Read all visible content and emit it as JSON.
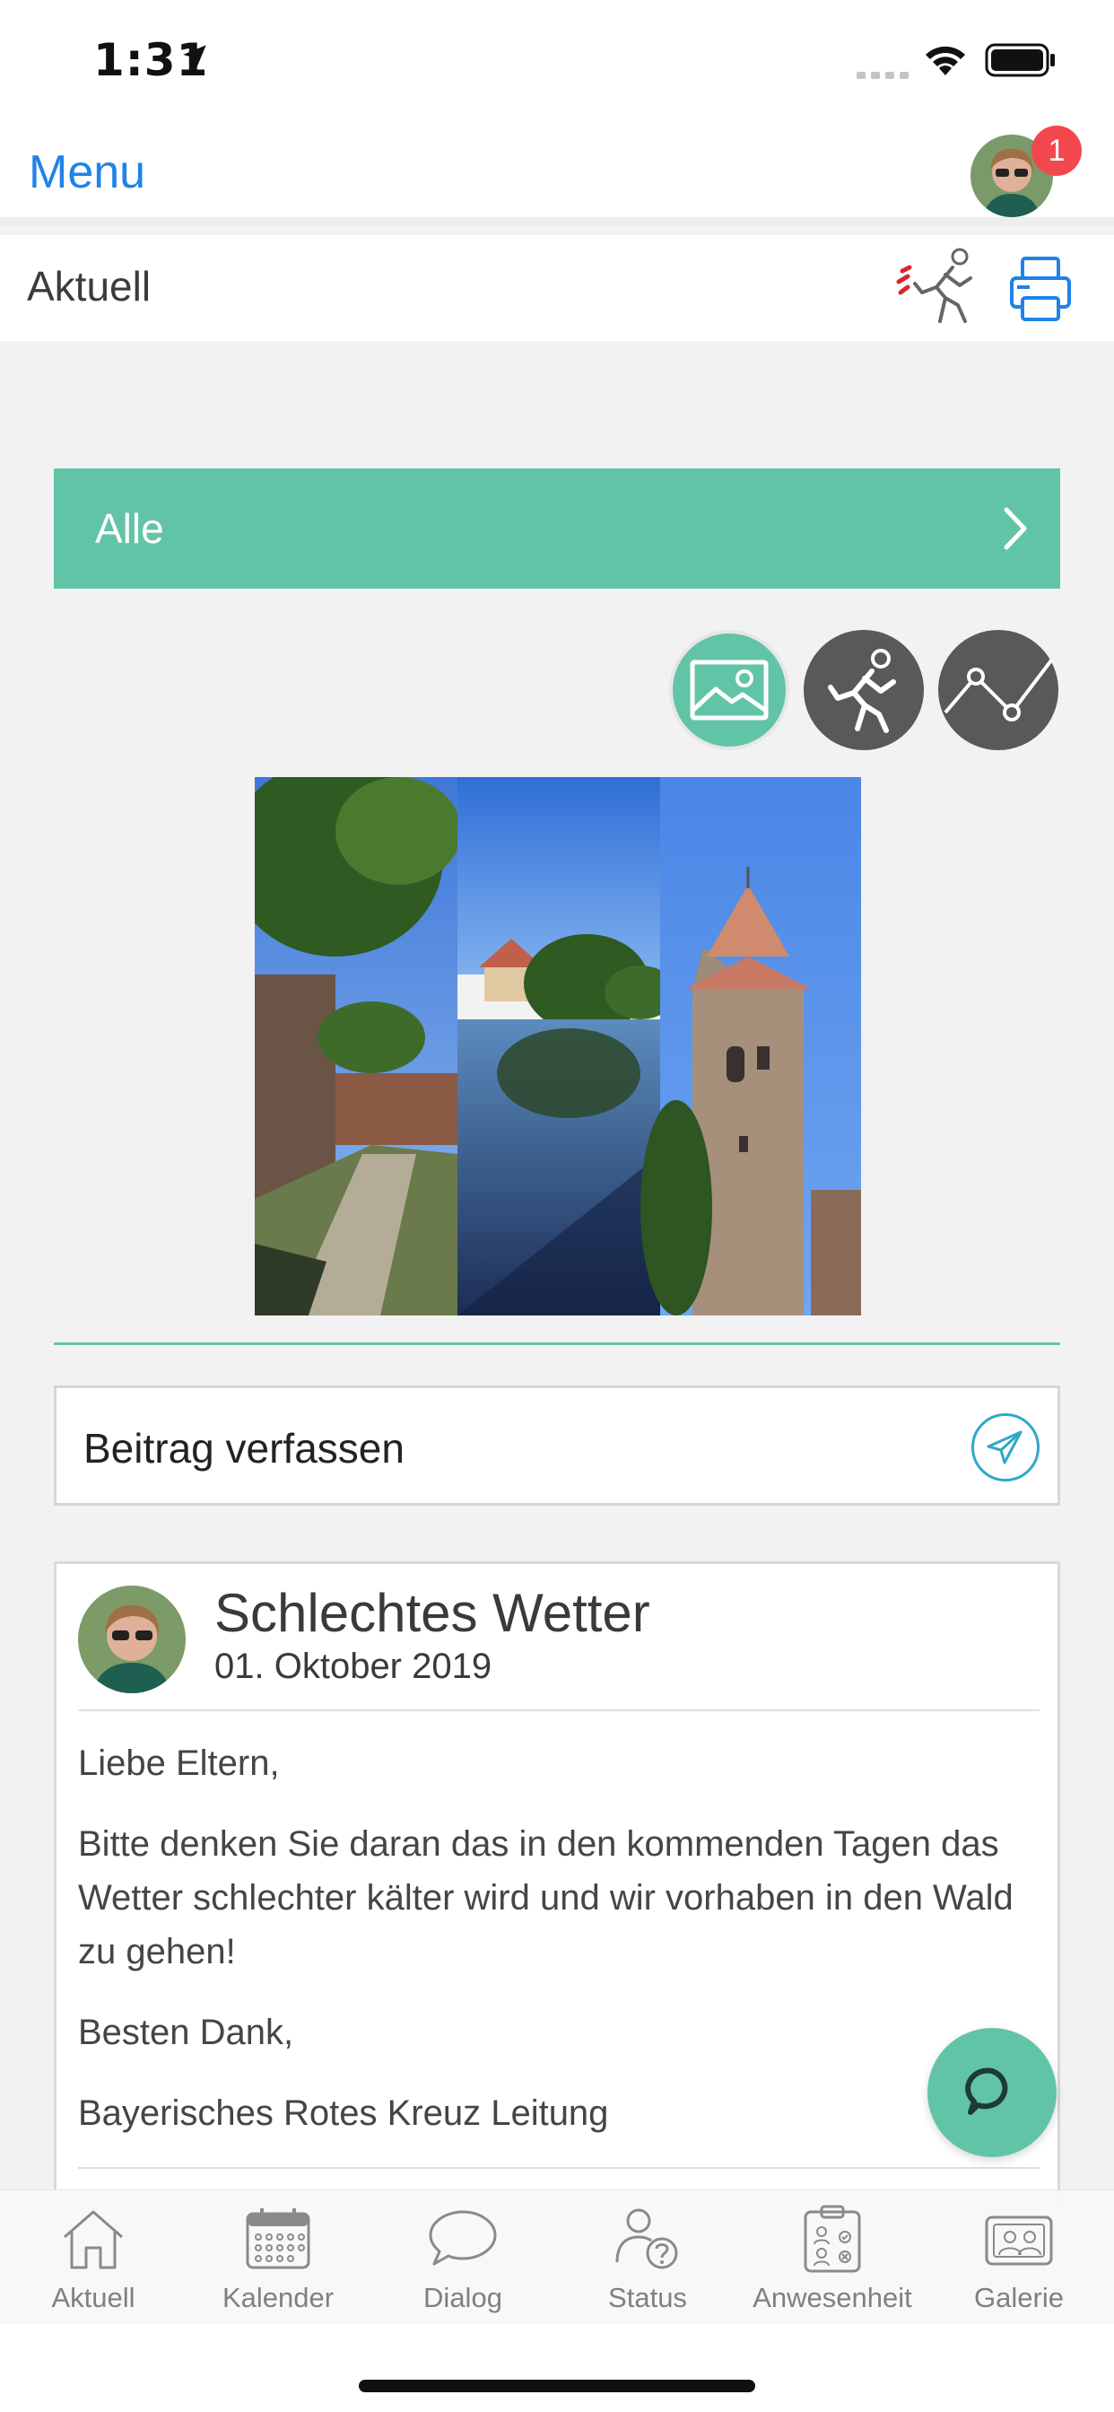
{
  "status_bar": {
    "time": "1:31"
  },
  "nav": {
    "menu_label": "Menu",
    "notification_count": "1"
  },
  "subheader": {
    "title": "Aktuell"
  },
  "filter": {
    "label": "Alle"
  },
  "compose": {
    "placeholder": "Beitrag verfassen"
  },
  "post": {
    "title": "Schlechtes Wetter",
    "date": "01. Oktober 2019",
    "paragraphs": [
      "Liebe Eltern,",
      "Bitte denken Sie daran das in den kommenden Tagen das Wetter schlechter kälter wird und wir vorhaben in den Wald zu gehen!",
      "Besten Dank,",
      "Bayerisches Rotes Kreuz Leitung"
    ]
  },
  "tabs": [
    {
      "label": "Aktuell",
      "icon": "home-icon"
    },
    {
      "label": "Kalender",
      "icon": "calendar-icon"
    },
    {
      "label": "Dialog",
      "icon": "chat-bubble-icon"
    },
    {
      "label": "Status",
      "icon": "person-question-icon"
    },
    {
      "label": "Anwesenheit",
      "icon": "attendance-clipboard-icon"
    },
    {
      "label": "Galerie",
      "icon": "gallery-icon"
    }
  ],
  "colors": {
    "accent_green": "#62c4a6",
    "link_blue": "#1f83e8",
    "badge_red": "#f2484d",
    "dark_circle": "#595959"
  }
}
